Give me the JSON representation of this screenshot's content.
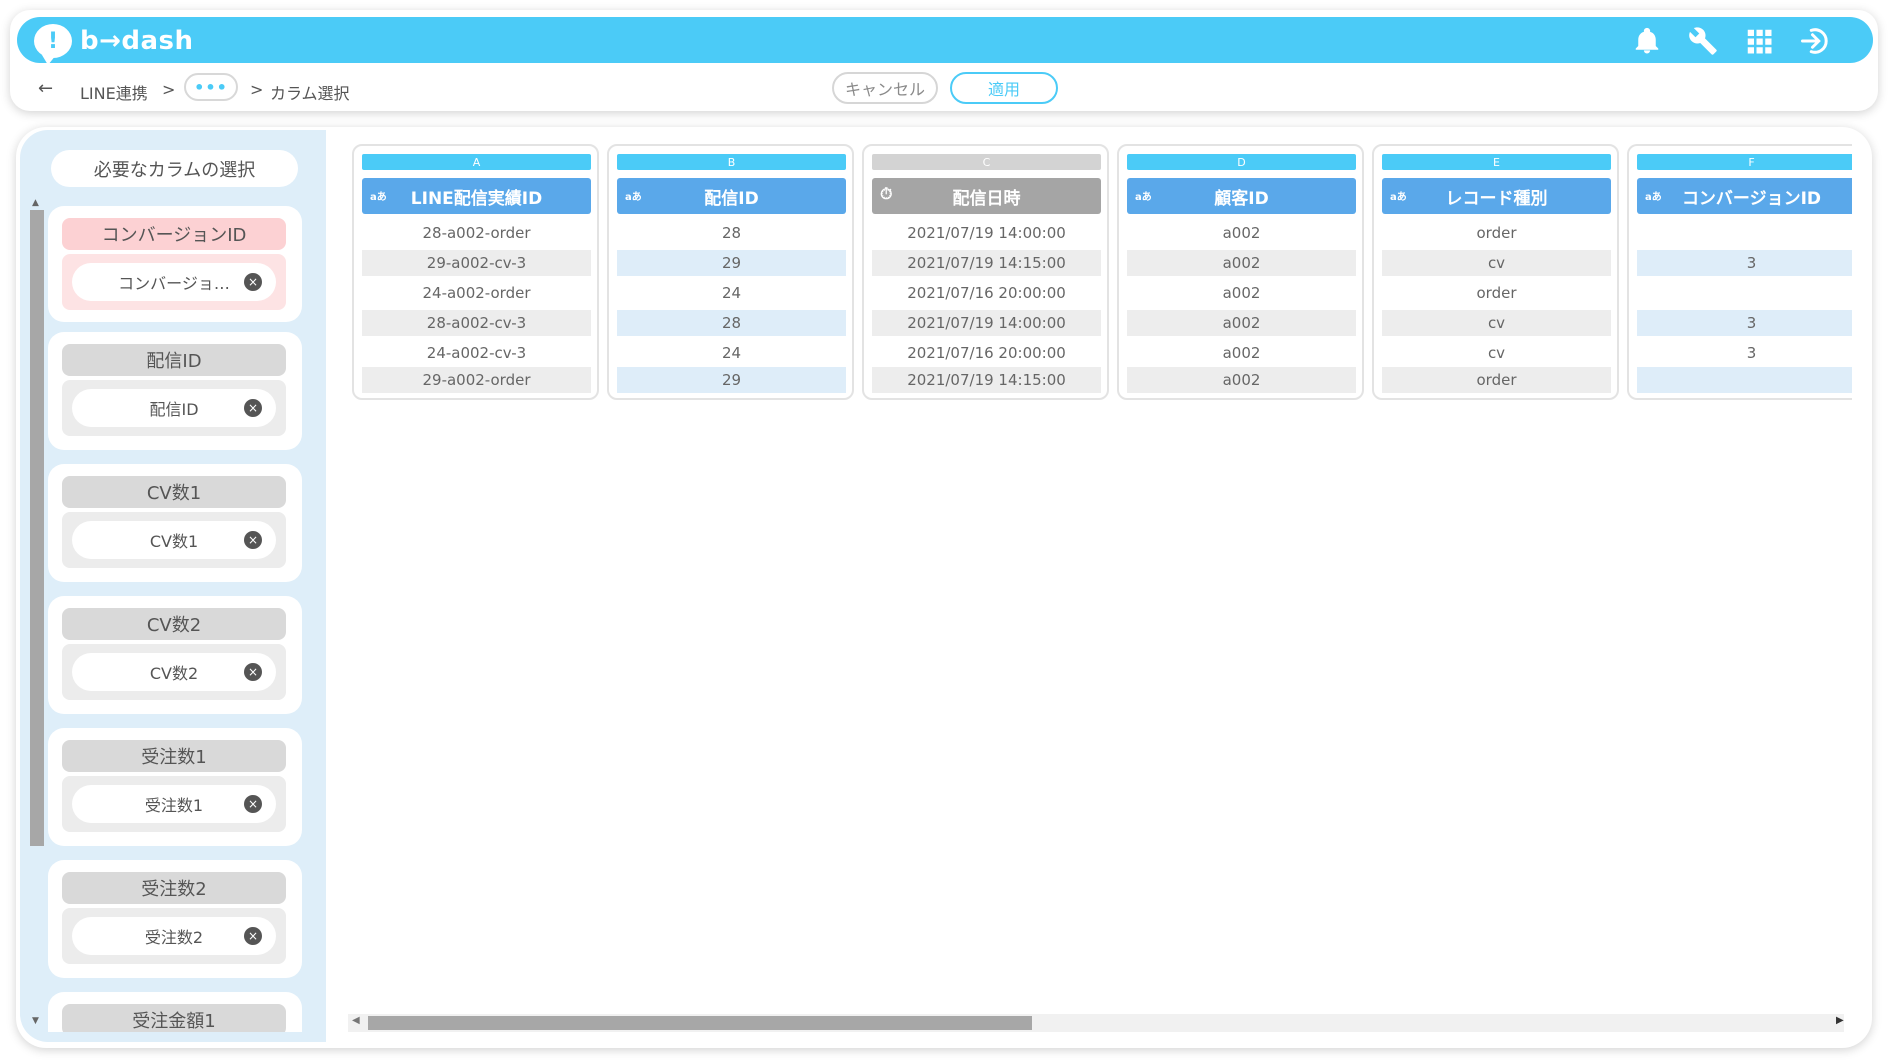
{
  "app": {
    "logo_text": "b→dash",
    "accent_color": "#4bcbf7",
    "header_icons": [
      "bell-icon",
      "wrench-icon",
      "apps-grid-icon",
      "logout-icon"
    ]
  },
  "breadcrumb": {
    "back_icon": "←",
    "items": [
      "LINE連携",
      "•••",
      "カラム選択"
    ],
    "separator": ">"
  },
  "actions": {
    "cancel_label": "キャンセル",
    "apply_label": "適用"
  },
  "sidebar": {
    "title": "必要なカラムの選択",
    "cards": [
      {
        "head": "コンバージョンID",
        "chip": "コンバージョ…",
        "required": true
      },
      {
        "head": "配信ID",
        "chip": "配信ID",
        "required": false
      },
      {
        "head": "CV数1",
        "chip": "CV数1",
        "required": false
      },
      {
        "head": "CV数2",
        "chip": "CV数2",
        "required": false
      },
      {
        "head": "受注数1",
        "chip": "受注数1",
        "required": false
      },
      {
        "head": "受注数2",
        "chip": "受注数2",
        "required": false
      },
      {
        "head": "受注金額1",
        "chip": "",
        "required": false
      }
    ],
    "remove_icon": "×"
  },
  "table": {
    "columns": [
      {
        "letter": "A",
        "name": "LINE配信実績ID",
        "type_icon": "aあ",
        "type": "text",
        "cells": [
          "28-a002-order",
          "29-a002-cv-3",
          "24-a002-order",
          "28-a002-cv-3",
          "24-a002-cv-3",
          "29-a002-order"
        ]
      },
      {
        "letter": "B",
        "name": "配信ID",
        "type_icon": "aあ",
        "type": "text",
        "cells": [
          "28",
          "29",
          "24",
          "28",
          "24",
          "29"
        ]
      },
      {
        "letter": "C",
        "name": "配信日時",
        "type_icon": "⏱",
        "type": "datetime",
        "cells": [
          "2021/07/19 14:00:00",
          "2021/07/19 14:15:00",
          "2021/07/16 20:00:00",
          "2021/07/19 14:00:00",
          "2021/07/16 20:00:00",
          "2021/07/19 14:15:00"
        ]
      },
      {
        "letter": "D",
        "name": "顧客ID",
        "type_icon": "aあ",
        "type": "text",
        "cells": [
          "a002",
          "a002",
          "a002",
          "a002",
          "a002",
          "a002"
        ]
      },
      {
        "letter": "E",
        "name": "レコード種別",
        "type_icon": "aあ",
        "type": "text",
        "cells": [
          "order",
          "cv",
          "order",
          "cv",
          "cv",
          "order"
        ]
      },
      {
        "letter": "F",
        "name": "コンバージョンID",
        "type_icon": "aあ",
        "type": "text",
        "cells": [
          "",
          "3",
          "",
          "3",
          "3",
          ""
        ]
      }
    ]
  }
}
